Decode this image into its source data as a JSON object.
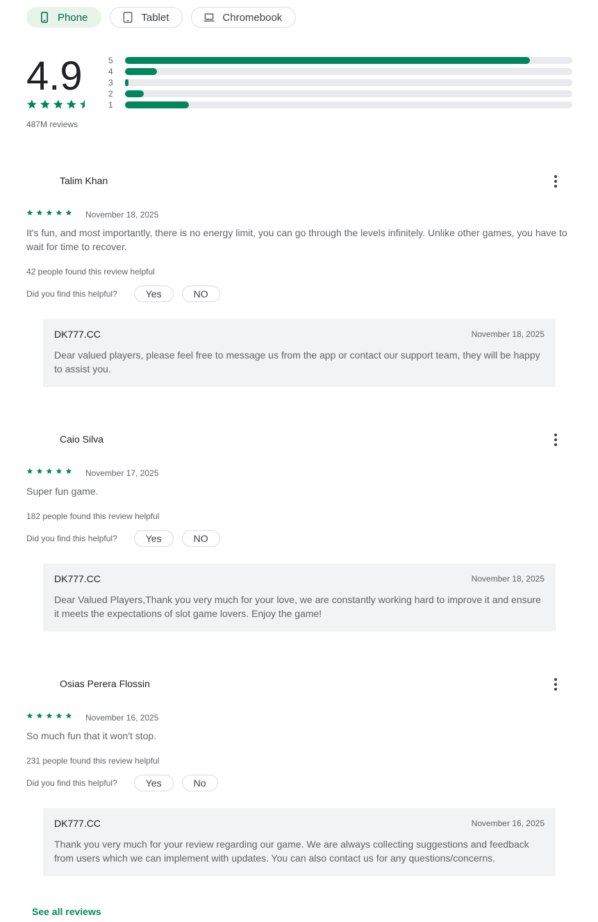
{
  "device_tabs": [
    {
      "label": "Phone",
      "icon": "phone-icon",
      "active": true
    },
    {
      "label": "Tablet",
      "icon": "tablet-icon",
      "active": false
    },
    {
      "label": "Chromebook",
      "icon": "laptop-icon",
      "active": false
    }
  ],
  "summary": {
    "rating": "4.9",
    "stars": 4.5,
    "reviews_count": "487M reviews",
    "histogram": [
      {
        "label": "5",
        "fraction": 0.905
      },
      {
        "label": "4",
        "fraction": 0.072
      },
      {
        "label": "3",
        "fraction": 0.008
      },
      {
        "label": "2",
        "fraction": 0.042
      },
      {
        "label": "1",
        "fraction": 0.143
      }
    ]
  },
  "colors": {
    "accent": "#01875f",
    "active_chip_bg": "#e6f4ea",
    "reply_bg": "#f1f3f4"
  },
  "reviews": [
    {
      "author": "Talim Khan",
      "stars": 5,
      "date": "November 18, 2025",
      "text": "It's fun, and most importantly, there is no energy limit, you can go through the levels infinitely. Unlike other games, you have to wait for time to recover.",
      "helpful_count": "42 people found this review helpful",
      "helpful_prompt": "Did you find this helpful?",
      "yes": "Yes",
      "no": "NO",
      "reply": {
        "developer": "DK777.CC",
        "date": "November 18, 2025",
        "text": "Dear valued players, please feel free to message us from the app or contact our support team, they will be happy to assist you."
      }
    },
    {
      "author": "Caio Silva",
      "stars": 5,
      "date": "November 17, 2025",
      "text": "Super fun game.",
      "helpful_count": "182 people found this review helpful",
      "helpful_prompt": "Did you find this helpful?",
      "yes": "Yes",
      "no": "NO",
      "reply": {
        "developer": "DK777.CC",
        "date": "November 18, 2025",
        "text": "Dear Valued Players,Thank you very much for your love, we are constantly working hard to improve it and ensure it meets the expectations of slot game lovers. Enjoy the game!"
      }
    },
    {
      "author": "Osias Perera Flossin",
      "stars": 5,
      "date": "November 16, 2025",
      "text": "So much fun that it won't stop.",
      "helpful_count": "231 people found this review helpful",
      "helpful_prompt": "Did you find this helpful?",
      "yes": "Yes",
      "no": "No",
      "reply": {
        "developer": "DK777.CC",
        "date": "November 16, 2025",
        "text": "Thank you very much for your review regarding our game. We are always collecting suggestions and feedback from users which we can implement with updates. You can also contact us for any questions/concerns."
      }
    }
  ],
  "see_all": "See all reviews"
}
